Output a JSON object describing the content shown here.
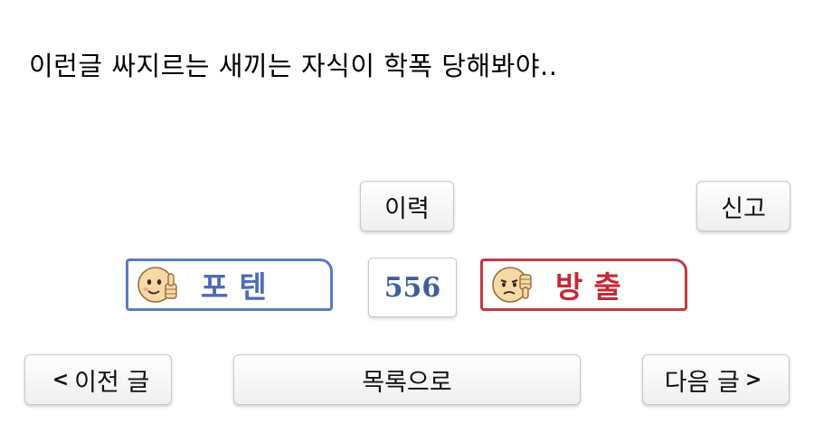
{
  "post": {
    "text": "이런글 싸지르는 새끼는 자식이 학폭 당해봐야.."
  },
  "actions": {
    "history_label": "이력",
    "report_label": "신고"
  },
  "vote": {
    "up_label": "포텐",
    "down_label": "방출",
    "count": "556",
    "up_color": "#5a79bf",
    "down_color": "#c23a44"
  },
  "nav": {
    "prev_arrow": "<",
    "prev_label": "이전 글",
    "list_label": "목록으로",
    "next_label": "다음 글",
    "next_arrow": ">"
  },
  "icons": {
    "up": "thumbs-up-face-icon",
    "down": "thumbs-down-face-icon"
  }
}
